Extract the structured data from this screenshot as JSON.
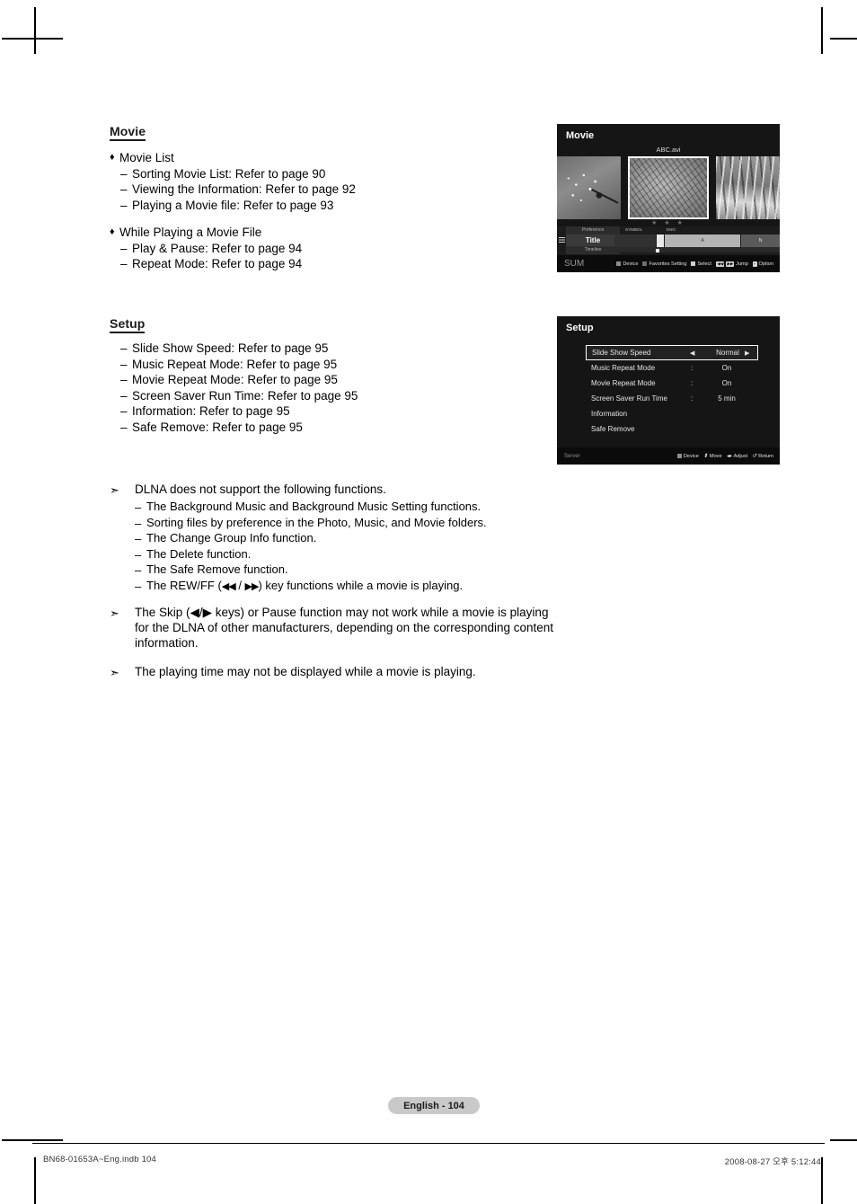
{
  "page": {
    "footer_pill": "English - 104",
    "footer_file": "BN68-01653A~Eng.indb   104",
    "footer_date": "2008-08-27   오후 5:12:44"
  },
  "movie_section": {
    "heading": "Movie",
    "groups": [
      {
        "bullet": "♦",
        "title": "Movie List",
        "items": [
          "Sorting Movie List: Refer to page 90",
          "Viewing the Information: Refer to page 92",
          "Playing a Movie file: Refer to page 93"
        ]
      },
      {
        "bullet": "♦",
        "title": "While Playing a Movie File",
        "items": [
          "Play & Pause: Refer to page 94",
          "Repeat Mode: Refer to page 94"
        ]
      }
    ]
  },
  "setup_section": {
    "heading": "Setup",
    "items": [
      "Slide Show Speed: Refer to page 95",
      "Music Repeat Mode: Refer to page 95",
      "Movie Repeat Mode: Refer to page 95",
      "Screen Saver Run Time: Refer to page 95",
      "Information: Refer to page 95",
      "Safe Remove: Refer to page 95"
    ]
  },
  "notes": {
    "note1": {
      "marker": "➣",
      "text": "DLNA does not support the following functions.",
      "subitems": [
        "The Background Music and Background Music Setting functions.",
        "Sorting files by preference in the Photo, Music, and Movie folders.",
        "The Change Group Info function.",
        "The Delete function.",
        "The Safe Remove function."
      ],
      "rewff_prefix": "The REW/FF (",
      "rewff_rew": "◀◀",
      "rewff_sep": " / ",
      "rewff_ff": "▶▶",
      "rewff_suffix": ") key functions while a movie is playing."
    },
    "note2": {
      "marker": "➣",
      "text": "The Skip (◀/▶ keys) or Pause function may not work while a movie is playing for the DLNA of other manufacturers, depending on the corresponding content information."
    },
    "note3": {
      "marker": "➣",
      "text": "The playing time may not be displayed while a movie is playing."
    }
  },
  "movie_osd": {
    "title": "Movie",
    "filename": "ABC.avi",
    "stars": "★ ★ ★",
    "tabs": {
      "preference": "Preference",
      "title": "Title",
      "timeline": "Timeline"
    },
    "columns": {
      "symbol": "SYMBOL",
      "eng": "ENG"
    },
    "segments": [
      "",
      "□",
      "A",
      "N"
    ],
    "footer_left": "SUM",
    "footer_keys": [
      {
        "icon": "square-grey",
        "label": "Device"
      },
      {
        "icon": "square-grey",
        "label": "Favorites Setting"
      },
      {
        "icon": "square-light",
        "label": "Select"
      },
      {
        "icon": "rew-ff-keys",
        "label": "Jump"
      },
      {
        "icon": "tools-icon",
        "label": "Option"
      }
    ]
  },
  "setup_osd": {
    "title": "Setup",
    "rows": [
      {
        "label": "Slide Show Speed",
        "colon": "",
        "value": "Normal",
        "selected": true,
        "arrow_left": "◀",
        "arrow_right": "▶"
      },
      {
        "label": "Music Repeat Mode",
        "colon": ":",
        "value": "On",
        "selected": false
      },
      {
        "label": "Movie Repeat Mode",
        "colon": ":",
        "value": "On",
        "selected": false
      },
      {
        "label": "Screen Saver Run Time",
        "colon": ":",
        "value": "5 min",
        "selected": false
      },
      {
        "label": "Information",
        "colon": "",
        "value": "",
        "selected": false
      },
      {
        "label": "Safe Remove",
        "colon": "",
        "value": "",
        "selected": false
      }
    ],
    "footer_left": "Server",
    "footer_keys": [
      {
        "icon": "square-grey",
        "label": "Device"
      },
      {
        "icon": "up-down-arrows",
        "label": "Move"
      },
      {
        "icon": "left-right-arrows",
        "label": "Adjust"
      },
      {
        "icon": "return-arrow",
        "label": "Return"
      }
    ]
  },
  "colors": {
    "osd_bg": "#151515",
    "osd_footer": "#0b0b0b",
    "pill_bg": "#c9c9c9"
  }
}
